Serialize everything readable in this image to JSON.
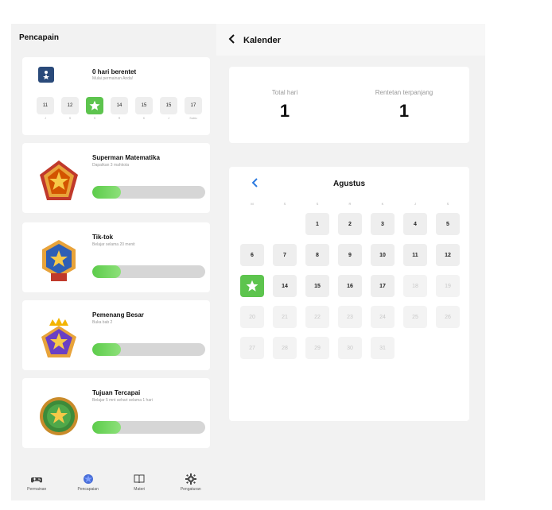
{
  "left": {
    "title": "Pencapain",
    "streak": {
      "title": "0 hari berentet",
      "subtitle": "Mulai permainan Anda!",
      "days": [
        {
          "num": "11",
          "label": "J",
          "today": false
        },
        {
          "num": "12",
          "label": "S",
          "today": false
        },
        {
          "num": "",
          "label": "S",
          "today": true
        },
        {
          "num": "14",
          "label": "R",
          "today": false
        },
        {
          "num": "15",
          "label": "K",
          "today": false
        },
        {
          "num": "15",
          "label": "J",
          "today": false
        },
        {
          "num": "17",
          "label": "Sabtu",
          "today": false
        }
      ]
    },
    "badges": [
      {
        "title": "Superman Matematika",
        "subtitle": "Dapatkan 3 mahkota",
        "progress": 0.25,
        "icon": "pentagon-star-badge-icon"
      },
      {
        "title": "Tik-tok",
        "subtitle": "Belajar selama 20 menit",
        "progress": 0.25,
        "icon": "hexagon-star-badge-icon"
      },
      {
        "title": "Pemenang Besar",
        "subtitle": "Buka bab 2",
        "progress": 0.25,
        "icon": "crown-star-badge-icon"
      },
      {
        "title": "Tujuan Tercapai",
        "subtitle": "Belajar 5 mnt sehari selama 1 hari",
        "progress": 0.25,
        "icon": "round-star-badge-icon"
      }
    ],
    "nav": [
      {
        "label": "Permainan",
        "icon": "gamepad-icon"
      },
      {
        "label": "Pencapaian",
        "icon": "achievement-icon"
      },
      {
        "label": "Materi",
        "icon": "book-icon"
      },
      {
        "label": "Pengaturan",
        "icon": "gear-icon"
      }
    ]
  },
  "right": {
    "title": "Kalender",
    "stats": {
      "total_label": "Total hari",
      "total_value": "1",
      "streak_label": "Rentetan terpanjang",
      "streak_value": "1"
    },
    "calendar": {
      "month": "Agustus",
      "weekdays": [
        "M",
        "S",
        "S",
        "R",
        "K",
        "J",
        "S"
      ],
      "cells": [
        {
          "num": "",
          "state": "empty"
        },
        {
          "num": "",
          "state": "empty"
        },
        {
          "num": "1",
          "state": "past"
        },
        {
          "num": "2",
          "state": "past"
        },
        {
          "num": "3",
          "state": "past"
        },
        {
          "num": "4",
          "state": "past"
        },
        {
          "num": "5",
          "state": "past"
        },
        {
          "num": "6",
          "state": "past"
        },
        {
          "num": "7",
          "state": "past"
        },
        {
          "num": "8",
          "state": "past"
        },
        {
          "num": "9",
          "state": "past"
        },
        {
          "num": "10",
          "state": "past"
        },
        {
          "num": "11",
          "state": "past"
        },
        {
          "num": "12",
          "state": "past"
        },
        {
          "num": "",
          "state": "today"
        },
        {
          "num": "14",
          "state": "past"
        },
        {
          "num": "15",
          "state": "past"
        },
        {
          "num": "16",
          "state": "past"
        },
        {
          "num": "17",
          "state": "past"
        },
        {
          "num": "18",
          "state": "future"
        },
        {
          "num": "19",
          "state": "future"
        },
        {
          "num": "20",
          "state": "future"
        },
        {
          "num": "21",
          "state": "future"
        },
        {
          "num": "22",
          "state": "future"
        },
        {
          "num": "23",
          "state": "future"
        },
        {
          "num": "24",
          "state": "future"
        },
        {
          "num": "25",
          "state": "future"
        },
        {
          "num": "26",
          "state": "future"
        },
        {
          "num": "27",
          "state": "future"
        },
        {
          "num": "28",
          "state": "future"
        },
        {
          "num": "29",
          "state": "future"
        },
        {
          "num": "30",
          "state": "future"
        },
        {
          "num": "31",
          "state": "future"
        }
      ]
    }
  },
  "colors": {
    "accent": "#5dc44e",
    "panel": "#f2f2f2"
  }
}
